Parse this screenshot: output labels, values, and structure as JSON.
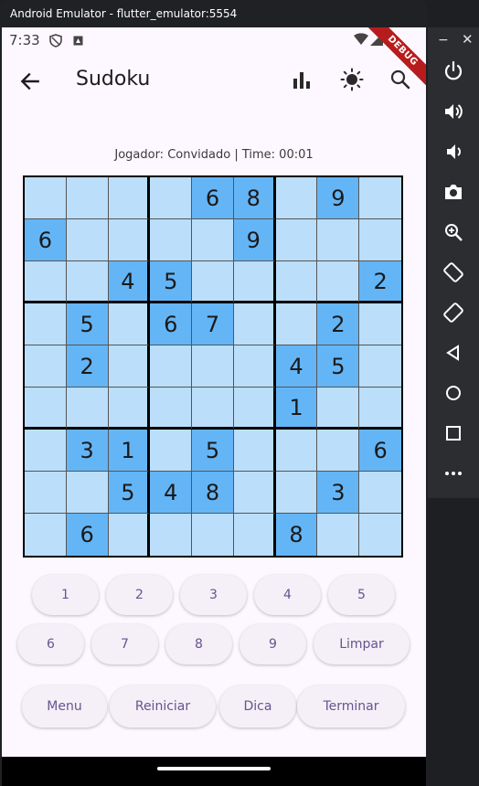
{
  "window": {
    "title": "Android Emulator - flutter_emulator:5554"
  },
  "status_bar": {
    "time": "7:33",
    "debug_banner": "DEBUG"
  },
  "app_bar": {
    "title": "Sudoku",
    "icons": [
      "arrow-back-icon",
      "bar-chart-icon",
      "brightness-icon",
      "search-icon"
    ]
  },
  "game": {
    "info": "Jogador: Convidado | Time: 00:01",
    "board": [
      [
        "",
        "",
        "",
        "",
        "6",
        "8",
        "",
        "9",
        ""
      ],
      [
        "6",
        "",
        "",
        "",
        "",
        "9",
        "",
        "",
        ""
      ],
      [
        "",
        "",
        "4",
        "5",
        "",
        "",
        "",
        "",
        "2"
      ],
      [
        "",
        "5",
        "",
        "6",
        "7",
        "",
        "",
        "2",
        ""
      ],
      [
        "",
        "2",
        "",
        "",
        "",
        "",
        "4",
        "5",
        ""
      ],
      [
        "",
        "",
        "",
        "",
        "",
        "",
        "1",
        "",
        ""
      ],
      [
        "",
        "3",
        "1",
        "",
        "5",
        "",
        "",
        "",
        "6"
      ],
      [
        "",
        "",
        "5",
        "4",
        "8",
        "",
        "",
        "3",
        ""
      ],
      [
        "",
        "6",
        "",
        "",
        "",
        "",
        "8",
        "",
        ""
      ]
    ],
    "highlighted": [
      [
        0,
        4
      ],
      [
        0,
        5
      ],
      [
        0,
        7
      ],
      [
        1,
        0
      ],
      [
        1,
        5
      ],
      [
        2,
        2
      ],
      [
        2,
        3
      ],
      [
        2,
        8
      ],
      [
        3,
        1
      ],
      [
        3,
        3
      ],
      [
        3,
        4
      ],
      [
        3,
        7
      ],
      [
        4,
        1
      ],
      [
        4,
        6
      ],
      [
        4,
        7
      ],
      [
        5,
        6
      ],
      [
        6,
        1
      ],
      [
        6,
        2
      ],
      [
        6,
        4
      ],
      [
        6,
        8
      ],
      [
        7,
        2
      ],
      [
        7,
        3
      ],
      [
        7,
        4
      ],
      [
        7,
        7
      ],
      [
        8,
        1
      ],
      [
        8,
        6
      ]
    ]
  },
  "number_pad": {
    "row1": [
      "1",
      "2",
      "3",
      "4",
      "5"
    ],
    "row2": [
      "6",
      "7",
      "8",
      "9",
      "Limpar"
    ]
  },
  "actions": [
    "Menu",
    "Reiniciar",
    "Dica",
    "Terminar"
  ],
  "emulator_toolbar": {
    "minimize": "−",
    "close": "✕",
    "buttons": [
      "power-icon",
      "volume-up-icon",
      "volume-down-icon",
      "camera-icon",
      "zoom-icon",
      "rotate-left-icon",
      "rotate-right-icon",
      "back-icon",
      "home-icon",
      "overview-icon",
      "more-icon"
    ]
  },
  "colors": {
    "cell": "#bbdefb",
    "cell_given": "#64b5f6",
    "background": "#fdf7ff",
    "button_text": "#65558f"
  }
}
